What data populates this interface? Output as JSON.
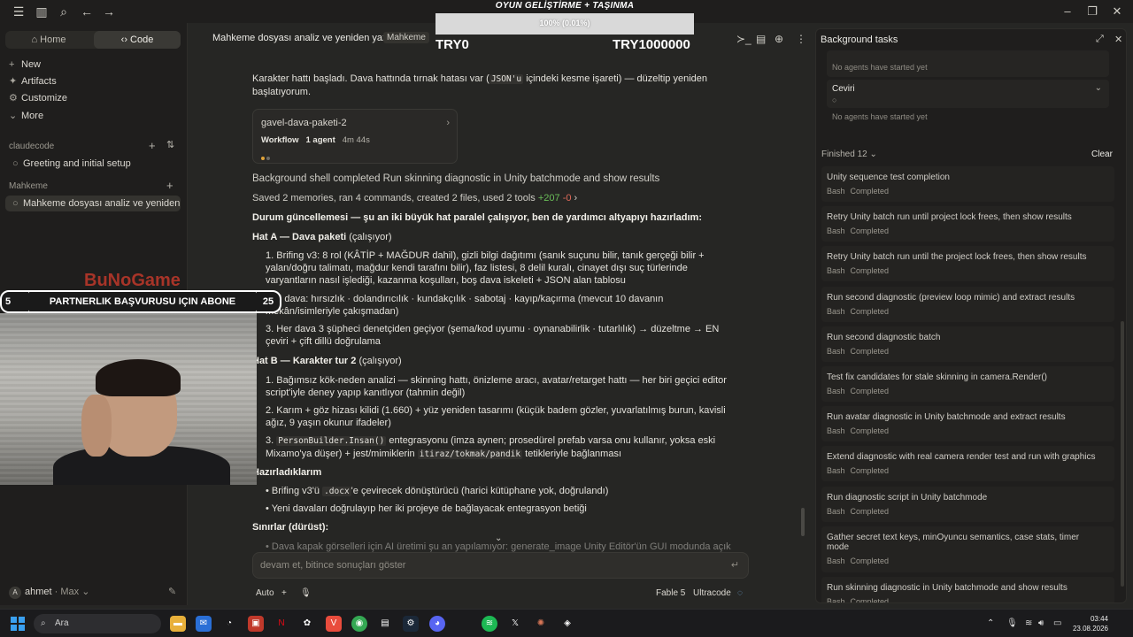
{
  "overlay": {
    "title": "OYUN GELİŞTİRME + TAŞINMA",
    "progress_label": "100% (0.01%)",
    "progress_fraction": 0.0001,
    "left_value": "TRY0",
    "right_value": "TRY1000000",
    "logo_text": "BuNoGame",
    "banner_text": "PARTNERLIK BAŞVURUSU IÇIN ABONE",
    "banner_left_num": "5",
    "banner_right_num": "25"
  },
  "sidebar": {
    "tabs": {
      "home": "Home",
      "code": "Code"
    },
    "nav": [
      {
        "label": "New",
        "icon": "+"
      },
      {
        "label": "Artifacts",
        "icon": "✦"
      },
      {
        "label": "Customize",
        "icon": "⚙"
      },
      {
        "label": "More",
        "icon": "⌄"
      }
    ],
    "section1": "claudecode",
    "section1_items": [
      "Greeting and initial setup"
    ],
    "section2": "Mahkeme",
    "section2_items": [
      "Mahkeme dosyası analiz ve yeniden yazım"
    ],
    "user": {
      "name": "ahmet",
      "plan": "· Max",
      "initial": "A"
    }
  },
  "main": {
    "title": "Mahkeme dosyası analiz ve yeniden yazım",
    "badge": "Mahkeme",
    "para1_a": "Karakter hattı başladı. Dava hattında tırnak hatası var (",
    "para1_code": "JSON'u",
    "para1_b": " içindeki kesme işareti) — düzeltip yeniden başlatıyorum.",
    "workflow": {
      "name": "gavel-dava-paketi-2",
      "kind": "Workflow",
      "agents": "1 agent",
      "time": "4m 44s"
    },
    "shell_line": "Background shell completed Run skinning diagnostic in Unity batchmode and show results",
    "memories_line": "Saved 2 memories, ran 4 commands, created 2 files, used 2 tools",
    "added": "+207",
    "removed": "-0",
    "status_line": "Durum güncellemesi — şu an iki büyük hat paralel çalışıyor, ben de yardımcı altyapıyı hazırladım:",
    "hat_a": "Hat A — Dava paketi",
    "hat_a_state": "(çalışıyor)",
    "item1": "1. Brifing v3: 8 rol (KÂTİP + MAĞDUR dahil), gizli bilgi dağıtımı (sanık suçunu bilir, tanık gerçeği bilir + yalan/doğru talimatı, mağdur kendi tarafını bilir), faz listesi, 8 delil kuralı, cinayet dışı suç türlerinde varyantların nasıl işlediği, kazanma koşulları, boş dava iskeleti + JSON alan tablosu",
    "item2": "2. 5 dava: hırsızlık · dolandırıcılık · kundakçılık · sabotaj · kayıp/kaçırma (mevcut 10 davanın mekân/isimleriyle çakışmadan)",
    "item3": "3. Her dava 3 şüpheci denetçiden geçiyor (şema/kod uyumu · oynanabilirlik · tutarlılık) → düzeltme → EN çeviri + çift dillü doğrulama",
    "hat_b": "Hat B — Karakter tur 2",
    "hat_b_state": "(çalışıyor)",
    "b1": "1. Bağımsız kök-neden analizi — skinning hattı, önizleme aracı, avatar/retarget hattı — her biri geçici editor script'iyle deney yapıp kanıtlıyor (tahmin değil)",
    "b2": "2. Karım + göz hizası kilidi (1.660) + yüz yeniden tasarımı (küçük badem gözler, yuvarlatılmış burun, kavisli ağız, 9 yaşın okunur ifadeler)",
    "b3_code": "PersonBuilder.Insan()",
    "b3": " entegrasyonu (imza aynen; prosedürel prefab varsa onu kullanır, yoksa eski Mixamo'ya düşer) + jest/mimiklerin ",
    "b3_code2": "itiraz/tokmak/pandik",
    "b3_end": " tetikleriyle bağlanması",
    "c_head": "Hazırladıklarım",
    "c1_a": "Brifing v3'ü ",
    "c1_code": ".docx",
    "c1_b": "'e çevirecek dönüştürücü (harici kütüphane yok, doğrulandı)",
    "c2": "Yeni davaları doğrulayıp her iki projeye de bağlayacak entegrasyon betiği",
    "limits": "Sınırlar (dürüst):",
    "limit1": "Dava kapak görselleri için AI üretimi şu an yapılamıyor: generate_image Unity Editör'ün GUI modunda açık",
    "input_placeholder": "devam et, bitince sonuçları göster",
    "mode": "Auto",
    "model": "Fable 5",
    "effort": "Ultracode"
  },
  "panel": {
    "title": "Background tasks",
    "no_agents": "No agents have started yet",
    "agent_name": "Ceviri",
    "finished_label": "Finished 12",
    "clear": "Clear",
    "tasks": [
      {
        "title": "Unity sequence test completion",
        "kind": "Bash",
        "status": "Completed"
      },
      {
        "title": "Retry Unity batch run until project lock frees, then show results",
        "kind": "Bash",
        "status": "Completed"
      },
      {
        "title": "Retry Unity batch run until the project lock frees, then show results",
        "kind": "Bash",
        "status": "Completed"
      },
      {
        "title": "Run second diagnostic (preview loop mimic) and extract results",
        "kind": "Bash",
        "status": "Completed"
      },
      {
        "title": "Run second diagnostic batch",
        "kind": "Bash",
        "status": "Completed"
      },
      {
        "title": "Test fix candidates for stale skinning in camera.Render()",
        "kind": "Bash",
        "status": "Completed"
      },
      {
        "title": "Run avatar diagnostic in Unity batchmode and extract results",
        "kind": "Bash",
        "status": "Completed"
      },
      {
        "title": "Extend diagnostic with real camera render test and run with graphics",
        "kind": "Bash",
        "status": "Completed"
      },
      {
        "title": "Run diagnostic script in Unity batchmode",
        "kind": "Bash",
        "status": "Completed"
      },
      {
        "title": "Gather secret text keys, minOyuncu semantics, case stats, timer mode",
        "kind": "Bash",
        "status": "Completed"
      },
      {
        "title": "Run skinning diagnostic in Unity batchmode and show results",
        "kind": "Bash",
        "status": "Completed"
      }
    ]
  },
  "taskbar": {
    "search": "Ara",
    "time": "03:44",
    "date": "23.08.2026",
    "lang": "TUR"
  },
  "colors": {
    "accent": "#d97757",
    "added": "#6bbf59",
    "removed": "#e06a5a"
  }
}
